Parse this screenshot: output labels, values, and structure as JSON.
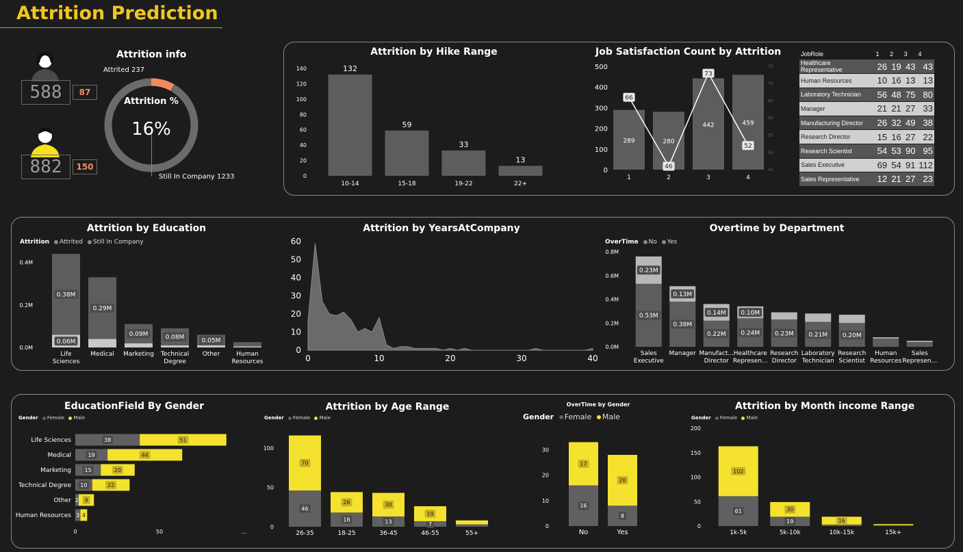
{
  "page": {
    "title": "Attrition Prediction"
  },
  "attrition_info": {
    "title": "Attrition info",
    "female_total": "588",
    "female_attrited": "87",
    "male_total": "882",
    "male_attrited": "150",
    "attrited_label": "Attrited 237",
    "still_label": "Still In Company 1233",
    "percent_label": "Attrition %",
    "percent_value": "16%",
    "colors": {
      "attrited": "#f08a5d",
      "still": "#6b6b6b",
      "female_icon": "#111111",
      "male_icon": "#f5e11b"
    }
  },
  "hike": {
    "title": "Attrition by Hike Range",
    "chart_data": {
      "type": "bar",
      "categories": [
        "10-14",
        "15-18",
        "19-22",
        "22+"
      ],
      "values": [
        132,
        59,
        33,
        13
      ],
      "ylim": [
        0,
        140
      ],
      "yticks": [
        "0",
        "20",
        "40",
        "60",
        "80",
        "100",
        "120",
        "140"
      ]
    }
  },
  "jobsat": {
    "title": "Job Satisfaction Count by Attrition",
    "chart_data": {
      "type": "bar",
      "categories": [
        "1",
        "2",
        "3",
        "4"
      ],
      "bars": [
        289,
        280,
        442,
        459
      ],
      "line": [
        66,
        46,
        73,
        52
      ],
      "ylim": [
        0,
        500
      ],
      "yticks": [
        "0",
        "100",
        "200",
        "300",
        "400",
        "500"
      ],
      "y2ticks": [
        "45",
        "50",
        "55",
        "60",
        "65",
        "70",
        "75"
      ]
    }
  },
  "jobrole_table": {
    "header": [
      "JobRole",
      "1",
      "2",
      "3",
      "4"
    ],
    "rows": [
      [
        "Healthcare Representative",
        "26",
        "19",
        "43",
        "43"
      ],
      [
        "Human Resources",
        "10",
        "16",
        "13",
        "13"
      ],
      [
        "Laboratory Technician",
        "56",
        "48",
        "75",
        "80"
      ],
      [
        "Manager",
        "21",
        "21",
        "27",
        "33"
      ],
      [
        "Manufacturing Director",
        "26",
        "32",
        "49",
        "38"
      ],
      [
        "Research Director",
        "15",
        "16",
        "27",
        "22"
      ],
      [
        "Research Scientist",
        "54",
        "53",
        "90",
        "95"
      ],
      [
        "Sales Executive",
        "69",
        "54",
        "91",
        "112"
      ],
      [
        "Sales Representative",
        "12",
        "21",
        "27",
        "23"
      ]
    ]
  },
  "education": {
    "title": "Attrition by Education",
    "legend_title": "Attrition",
    "legend": [
      "Attrited",
      "Still In Company"
    ],
    "chart_data": {
      "type": "bar",
      "categories": [
        [
          "Life",
          "Sciences"
        ],
        [
          "Medical"
        ],
        [
          "Marketing"
        ],
        [
          "Technical",
          "Degree"
        ],
        [
          "Other"
        ],
        [
          "Human",
          "Resources"
        ]
      ],
      "series": [
        {
          "name": "Attrited",
          "values": [
            0.06,
            0.04,
            0.02,
            0.01,
            0.01,
            0.005
          ],
          "labels": [
            "0.06M",
            "",
            "",
            "",
            "",
            ""
          ]
        },
        {
          "name": "Still In Company",
          "values": [
            0.38,
            0.29,
            0.09,
            0.08,
            0.05,
            0.02
          ],
          "labels": [
            "0.38M",
            "0.29M",
            "0.09M",
            "0.08M",
            "0.05M",
            ""
          ]
        }
      ],
      "ylim": [
        0,
        0.45
      ],
      "yticks": [
        "0.0M",
        "0.2M",
        "0.4M"
      ]
    }
  },
  "years": {
    "title": "Attrition by YearsAtCompany",
    "chart_data": {
      "type": "area",
      "x": [
        0,
        1,
        2,
        3,
        4,
        5,
        6,
        7,
        8,
        9,
        10,
        11,
        12,
        13,
        14,
        15,
        16,
        17,
        18,
        19,
        20,
        21,
        22,
        23,
        24,
        25,
        26,
        27,
        28,
        29,
        30,
        31,
        32,
        33,
        34,
        35,
        36,
        37,
        38,
        39,
        40
      ],
      "y": [
        16,
        59,
        27,
        20,
        19,
        21,
        17,
        10,
        12,
        10,
        18,
        3,
        1,
        2,
        2,
        1,
        1,
        1,
        1,
        0,
        1,
        0,
        1,
        0,
        0,
        0,
        0,
        0,
        0,
        0,
        0,
        0,
        1,
        0,
        0,
        0,
        0,
        0,
        0,
        0,
        1
      ],
      "xlim": [
        0,
        40
      ],
      "ylim": [
        0,
        60
      ],
      "xticks": [
        "0",
        "10",
        "20",
        "30",
        "40"
      ],
      "yticks": [
        "0",
        "10",
        "20",
        "30",
        "40",
        "50",
        "60"
      ]
    }
  },
  "overtime_dept": {
    "title": "Overtime by Department",
    "legend_title": "OverTime",
    "legend": [
      "No",
      "Yes"
    ],
    "chart_data": {
      "type": "bar",
      "categories": [
        [
          "Sales",
          "Executive"
        ],
        [
          "Manager"
        ],
        [
          "Manufact...",
          "Director"
        ],
        [
          "Healthcare",
          "Represen..."
        ],
        [
          "Research",
          "Director"
        ],
        [
          "Laboratory",
          "Technician"
        ],
        [
          "Research",
          "Scientist"
        ],
        [
          "Human",
          "Resources"
        ],
        [
          "Sales",
          "Represen..."
        ]
      ],
      "series": [
        {
          "name": "No",
          "values": [
            0.53,
            0.38,
            0.22,
            0.24,
            0.23,
            0.21,
            0.2,
            0.07,
            0.04
          ],
          "labels": [
            "0.53M",
            "0.38M",
            "0.22M",
            "0.24M",
            "0.23M",
            "0.21M",
            "0.20M",
            "",
            ""
          ]
        },
        {
          "name": "Yes",
          "values": [
            0.23,
            0.13,
            0.14,
            0.1,
            0.06,
            0.07,
            0.07,
            0.01,
            0.01
          ],
          "labels": [
            "0.23M",
            "0.13M",
            "0.14M",
            "0.10M",
            "",
            "",
            "",
            "",
            ""
          ]
        }
      ],
      "ylim": [
        0,
        0.8
      ],
      "yticks": [
        "0.0M",
        "0.2M",
        "0.4M",
        "0.6M",
        "0.8M"
      ]
    }
  },
  "edu_gender": {
    "title": "EducationField By Gender",
    "legend_title": "Gender",
    "legend": [
      "Female",
      "Male"
    ],
    "chart_data": {
      "type": "bar",
      "categories": [
        "Life Sciences",
        "Medical",
        "Marketing",
        "Technical Degree",
        "Other",
        "Human Resources"
      ],
      "series": [
        {
          "name": "Female",
          "values": [
            38,
            19,
            15,
            10,
            2,
            3
          ]
        },
        {
          "name": "Male",
          "values": [
            51,
            44,
            20,
            22,
            9,
            4
          ]
        }
      ],
      "xlim": [
        0,
        100
      ],
      "xticks": [
        "0",
        "50",
        "..."
      ]
    }
  },
  "age": {
    "title": "Attrition by Age Range",
    "legend_title": "Gender",
    "legend": [
      "Female",
      "Male"
    ],
    "chart_data": {
      "type": "bar",
      "categories": [
        "26-35",
        "18-25",
        "36-45",
        "46-55",
        "55+"
      ],
      "series": [
        {
          "name": "Female",
          "values": [
            46,
            18,
            13,
            7,
            3
          ],
          "labels": [
            "46",
            "18",
            "13",
            "7",
            ""
          ]
        },
        {
          "name": "Male",
          "values": [
            70,
            26,
            30,
            19,
            5
          ],
          "labels": [
            "70",
            "26",
            "30",
            "19",
            ""
          ]
        }
      ],
      "ylim": [
        0,
        120
      ],
      "yticks": [
        "0",
        "50",
        "100"
      ]
    }
  },
  "ot_gender": {
    "title": "OverTime by Gender",
    "legend_title": "Gender",
    "legend": [
      "Female",
      "Male"
    ],
    "chart_data": {
      "type": "bar",
      "categories": [
        "No",
        "Yes"
      ],
      "series": [
        {
          "name": "Female",
          "values": [
            16,
            8
          ]
        },
        {
          "name": "Male",
          "values": [
            17,
            20
          ]
        }
      ],
      "ylim": [
        0,
        35
      ],
      "yticks": [
        "0",
        "10",
        "20",
        "30"
      ]
    }
  },
  "income": {
    "title": "Attrition by Month income Range",
    "legend_title": "Gender",
    "legend": [
      "Female",
      "Male"
    ],
    "chart_data": {
      "type": "bar",
      "categories": [
        "1k-5k",
        "5k-10k",
        "10k-15k",
        "15k+"
      ],
      "series": [
        {
          "name": "Female",
          "values": [
            61,
            19,
            3,
            2
          ],
          "labels": [
            "61",
            "19",
            "",
            ""
          ]
        },
        {
          "name": "Male",
          "values": [
            102,
            30,
            16,
            2
          ],
          "labels": [
            "102",
            "30",
            "16",
            ""
          ]
        }
      ],
      "ylim": [
        0,
        200
      ],
      "yticks": [
        "0",
        "50",
        "100",
        "150",
        "200"
      ]
    }
  },
  "colors": {
    "bar": "#5d5d5d",
    "bar_light": "#b8b8b8",
    "male": "#f5e22e",
    "female": "#606060",
    "attrited": "#f08a5d",
    "panel_border": "#8a8a8a",
    "title": "#f2c520"
  }
}
